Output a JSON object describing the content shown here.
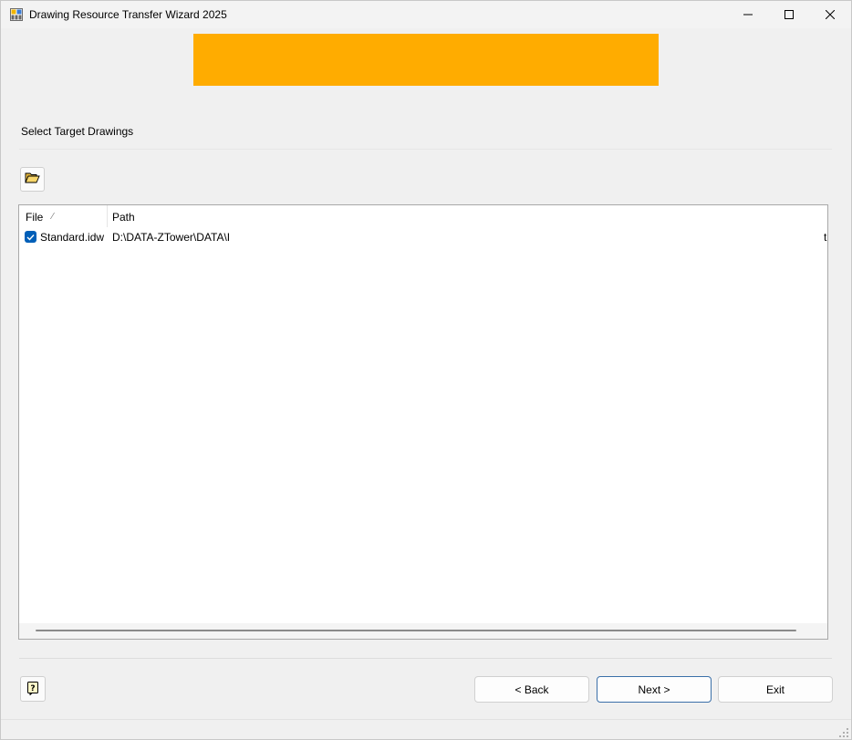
{
  "window": {
    "title": "Drawing Resource Transfer Wizard 2025",
    "app_icon": "grid-app-icon",
    "controls": [
      "minimize-icon",
      "maximize-icon",
      "close-icon"
    ]
  },
  "banner": {
    "color": "#ffac00"
  },
  "section": {
    "label": "Select Target Drawings"
  },
  "toolbar": {
    "open_icon": "folder-open-icon"
  },
  "list": {
    "columns": [
      {
        "label": "File",
        "sort": "sort-indicator-icon"
      },
      {
        "label": "Path"
      }
    ],
    "rows": [
      {
        "checked": true,
        "file": "Standard.idw",
        "path": "D:\\DATA-ZTower\\DATA\\I",
        "trailing": "t"
      }
    ]
  },
  "footer": {
    "help_icon": "help-icon",
    "back_label": "< Back",
    "next_label": "Next >",
    "exit_label": "Exit"
  },
  "colors": {
    "accent": "#005fb8",
    "banner": "#ffac00",
    "default_button_border": "#3a6fa8"
  }
}
